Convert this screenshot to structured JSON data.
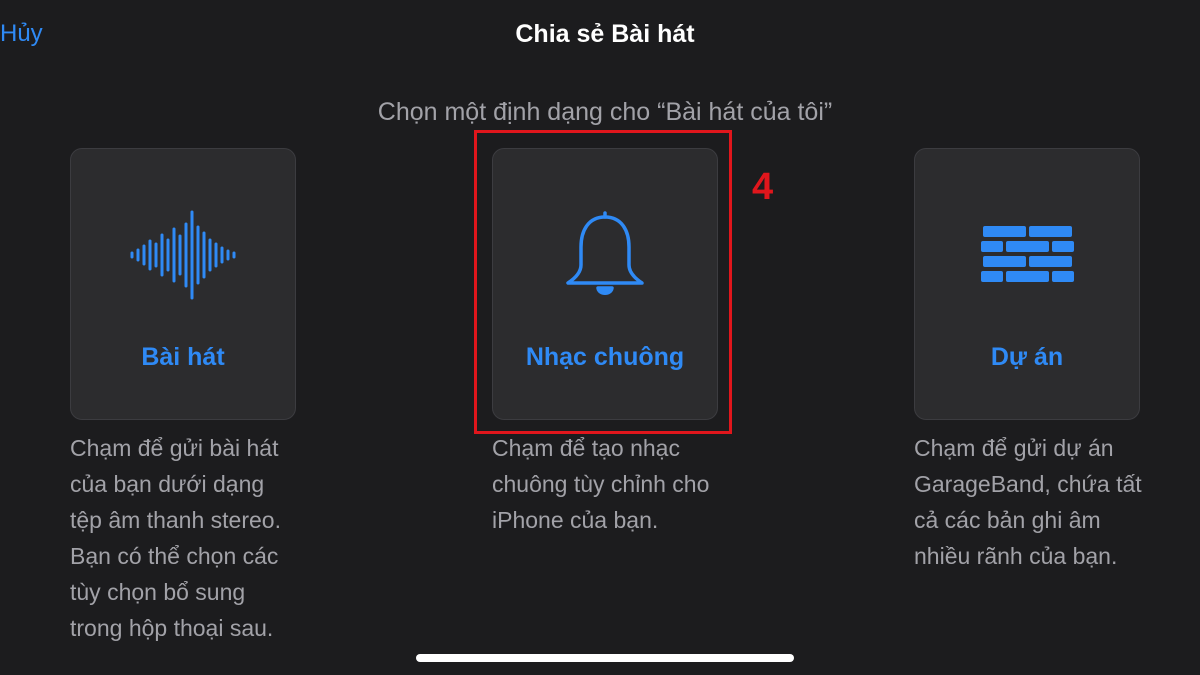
{
  "header": {
    "cancel_label": "Hủy",
    "title": "Chia sẻ Bài hát"
  },
  "subtitle": "Chọn một định dạng cho “Bài hát của tôi”",
  "options": [
    {
      "label": "Bài hát",
      "icon": "waveform-icon",
      "description": "Chạm để gửi bài hát của bạn dưới dạng tệp âm thanh stereo. Bạn có thể chọn các tùy chọn bổ sung trong hộp thoại sau."
    },
    {
      "label": "Nhạc chuông",
      "icon": "bell-icon",
      "description": "Chạm để tạo nhạc chuông tùy chỉnh cho iPhone của bạn."
    },
    {
      "label": "Dự án",
      "icon": "project-bricks-icon",
      "description": "Chạm để gửi dự án GarageBand, chứa tất cả các bản ghi âm nhiều rãnh của bạn."
    }
  ],
  "annotation": {
    "step_number": "4",
    "color": "#e0161c"
  },
  "colors": {
    "background": "#1c1c1e",
    "card": "#2c2c2e",
    "accent": "#2f8af5",
    "secondary_text": "#a2a2a8"
  }
}
